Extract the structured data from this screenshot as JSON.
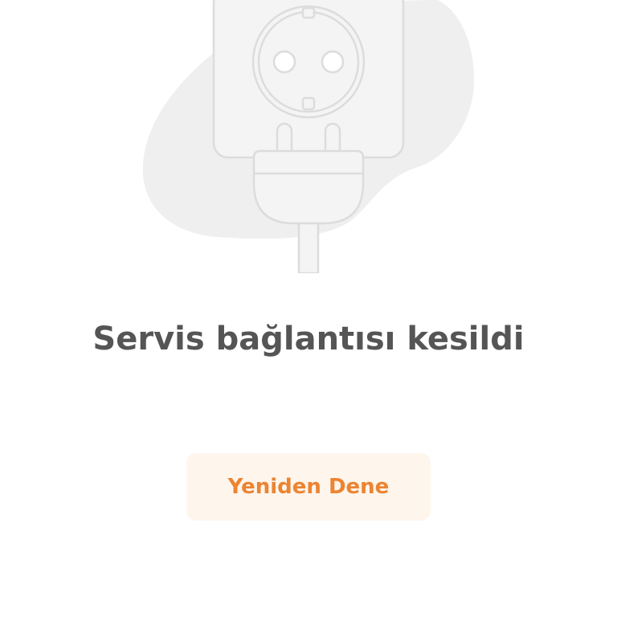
{
  "illustration": {
    "icon": "unplugged-socket-icon",
    "blob_color": "#efefef",
    "stroke_color": "#dcdcdc",
    "fill_color": "#f4f4f4"
  },
  "error": {
    "message": "Servis bağlantısı kesildi",
    "color": "#555555"
  },
  "retry": {
    "label": "Yeniden Dene",
    "text_color": "#ec8432",
    "background": "#fef5ec"
  }
}
